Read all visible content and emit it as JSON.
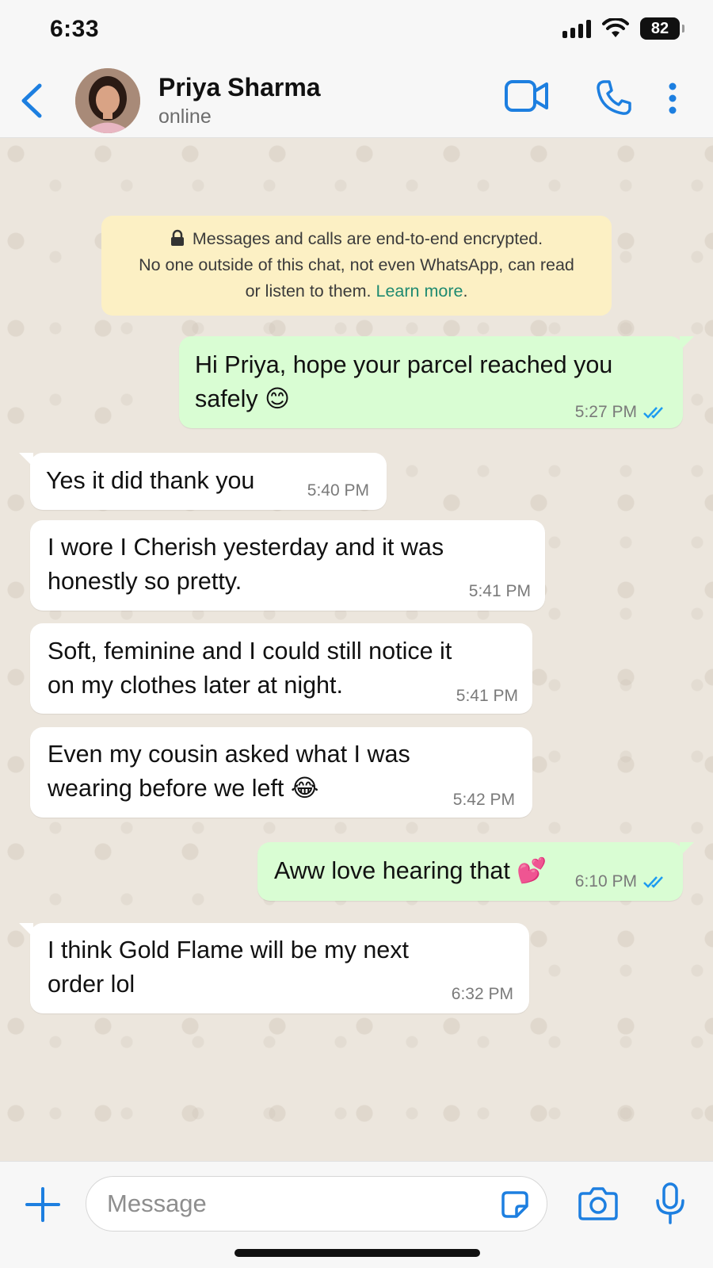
{
  "status_bar": {
    "time": "6:33",
    "battery": "82"
  },
  "header": {
    "contact_name": "Priya Sharma",
    "contact_status": "online",
    "accent_color": "#1d7fe0"
  },
  "encryption_notice": {
    "line1": "Messages and calls are end-to-end encrypted.",
    "line2": "No one outside of this chat, not even WhatsApp, can read",
    "line3_prefix": "or listen to them. ",
    "learn_more": "Learn more",
    "line3_suffix": "."
  },
  "messages": [
    {
      "direction": "outgoing",
      "line1": "Hi Priya, hope your parcel reached you",
      "line2": "safely 😊",
      "time": "5:27 PM",
      "status": "read"
    },
    {
      "direction": "incoming",
      "line1": "Yes it did thank you",
      "time": "5:40 PM"
    },
    {
      "direction": "incoming",
      "line1": "I wore I Cherish yesterday and it was",
      "line2": "honestly so pretty.",
      "time": "5:41 PM"
    },
    {
      "direction": "incoming",
      "line1": "Soft, feminine and I could still notice it",
      "line2": "on my clothes later at night.",
      "time": "5:41 PM"
    },
    {
      "direction": "incoming",
      "line1": "Even my cousin asked what I was",
      "line2": "wearing before we left 😂",
      "time": "5:42 PM"
    },
    {
      "direction": "outgoing",
      "line1": "Aww love hearing that 💕",
      "time": "6:10 PM",
      "status": "read"
    },
    {
      "direction": "incoming",
      "line1": "I think Gold Flame will be my next",
      "line2": "order lol",
      "time": "6:32 PM"
    }
  ],
  "input": {
    "placeholder": "Message"
  }
}
